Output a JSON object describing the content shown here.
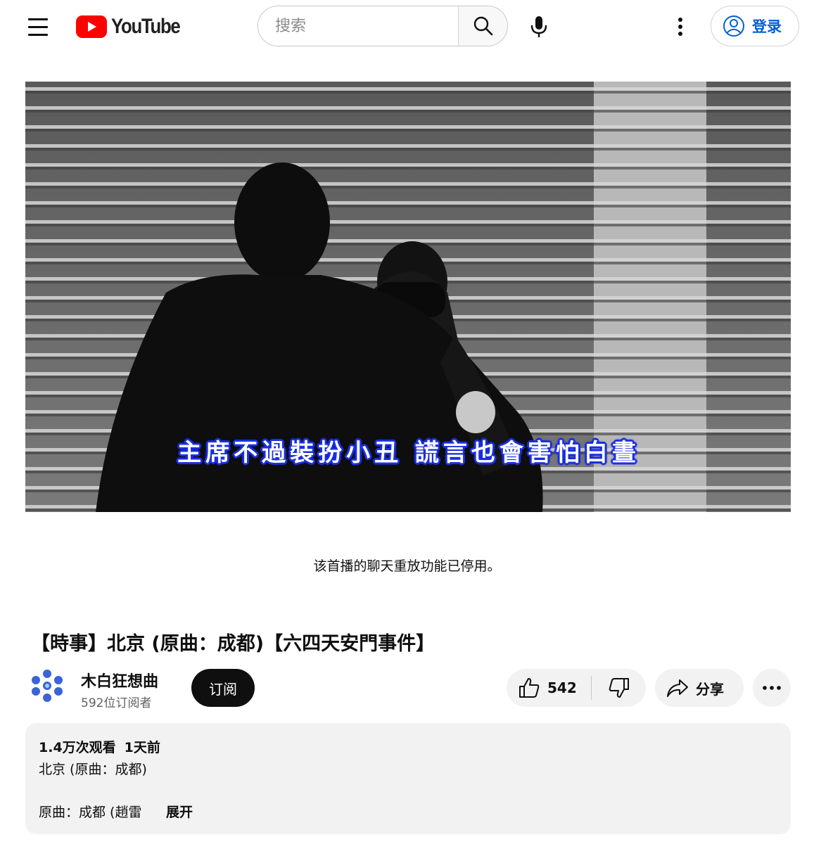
{
  "header": {
    "logo_text": "YouTube",
    "search_placeholder": "搜索",
    "signin_label": "登录",
    "colors": {
      "logo_red": "#ff0000",
      "signin_blue": "#065fd4"
    }
  },
  "video": {
    "subtitle": "主席不過裝扮小丑 謊言也會害怕白晝"
  },
  "chat_replay_notice": "该首播的聊天重放功能已停用。",
  "title": "【時事】北京 (原曲：成都)【六四天安門事件】",
  "channel": {
    "name": "木白狂想曲",
    "subscribers": "592位订阅者",
    "subscribe_label": "订阅"
  },
  "actions": {
    "like_count": "542",
    "share_label": "分享",
    "icons": [
      "thumbs-up-icon",
      "thumbs-down-icon",
      "share-arrow-icon",
      "more-horizontal-icon"
    ]
  },
  "description": {
    "views": "1.4万次观看",
    "published": "1天前",
    "line1": "北京 (原曲：成都)",
    "line2": "原曲：成都 (趙雷",
    "expand_label": "展开"
  }
}
